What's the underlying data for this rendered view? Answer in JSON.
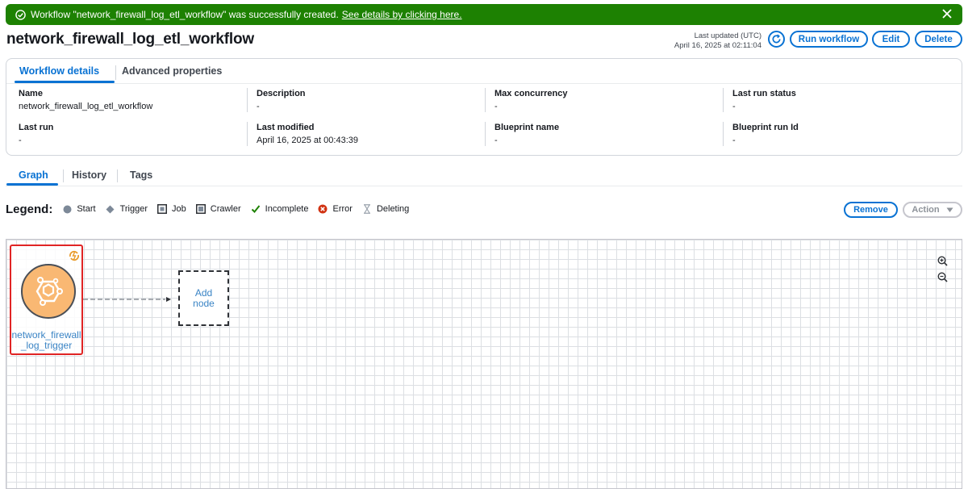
{
  "flash": {
    "message": "Workflow \"network_firewall_log_etl_workflow\" was successfully created.",
    "link_text": "See details by clicking here."
  },
  "header": {
    "title": "network_firewall_log_etl_workflow",
    "last_updated_label": "Last updated (UTC)",
    "last_updated_value": "April 16, 2025 at 02:11:04",
    "run_label": "Run workflow",
    "edit_label": "Edit",
    "delete_label": "Delete"
  },
  "details_tabs": [
    "Workflow details",
    "Advanced properties"
  ],
  "details": {
    "name": {
      "label": "Name",
      "value": "network_firewall_log_etl_workflow"
    },
    "description": {
      "label": "Description",
      "value": "-"
    },
    "max_concurrency": {
      "label": "Max concurrency",
      "value": "-"
    },
    "last_run_status": {
      "label": "Last run status",
      "value": "-"
    },
    "last_run": {
      "label": "Last run",
      "value": "-"
    },
    "last_modified": {
      "label": "Last modified",
      "value": "April 16, 2025 at 00:43:39"
    },
    "blueprint_name": {
      "label": "Blueprint name",
      "value": "-"
    },
    "blueprint_run_id": {
      "label": "Blueprint run Id",
      "value": "-"
    }
  },
  "graph_tabs": [
    "Graph",
    "History",
    "Tags"
  ],
  "legend": {
    "title": "Legend:",
    "items": [
      "Start",
      "Trigger",
      "Job",
      "Crawler",
      "Incomplete",
      "Error",
      "Deleting"
    ]
  },
  "graph_actions": {
    "remove_label": "Remove",
    "action_label": "Action"
  },
  "graph": {
    "trigger_node_label": "network_firewall_log_trigger",
    "add_node_line1": "Add",
    "add_node_line2": "node"
  },
  "colors": {
    "success": "#1d8102",
    "primary": "#0972d3",
    "node_fill": "#f9b873",
    "selection": "#e02424"
  },
  "icons": {
    "flash": "check-circle-icon",
    "close": "close-icon",
    "refresh": "refresh-icon",
    "trigger_node": "event-trigger-icon",
    "zoom_in": "zoom-in-icon",
    "zoom_out": "zoom-out-icon"
  }
}
